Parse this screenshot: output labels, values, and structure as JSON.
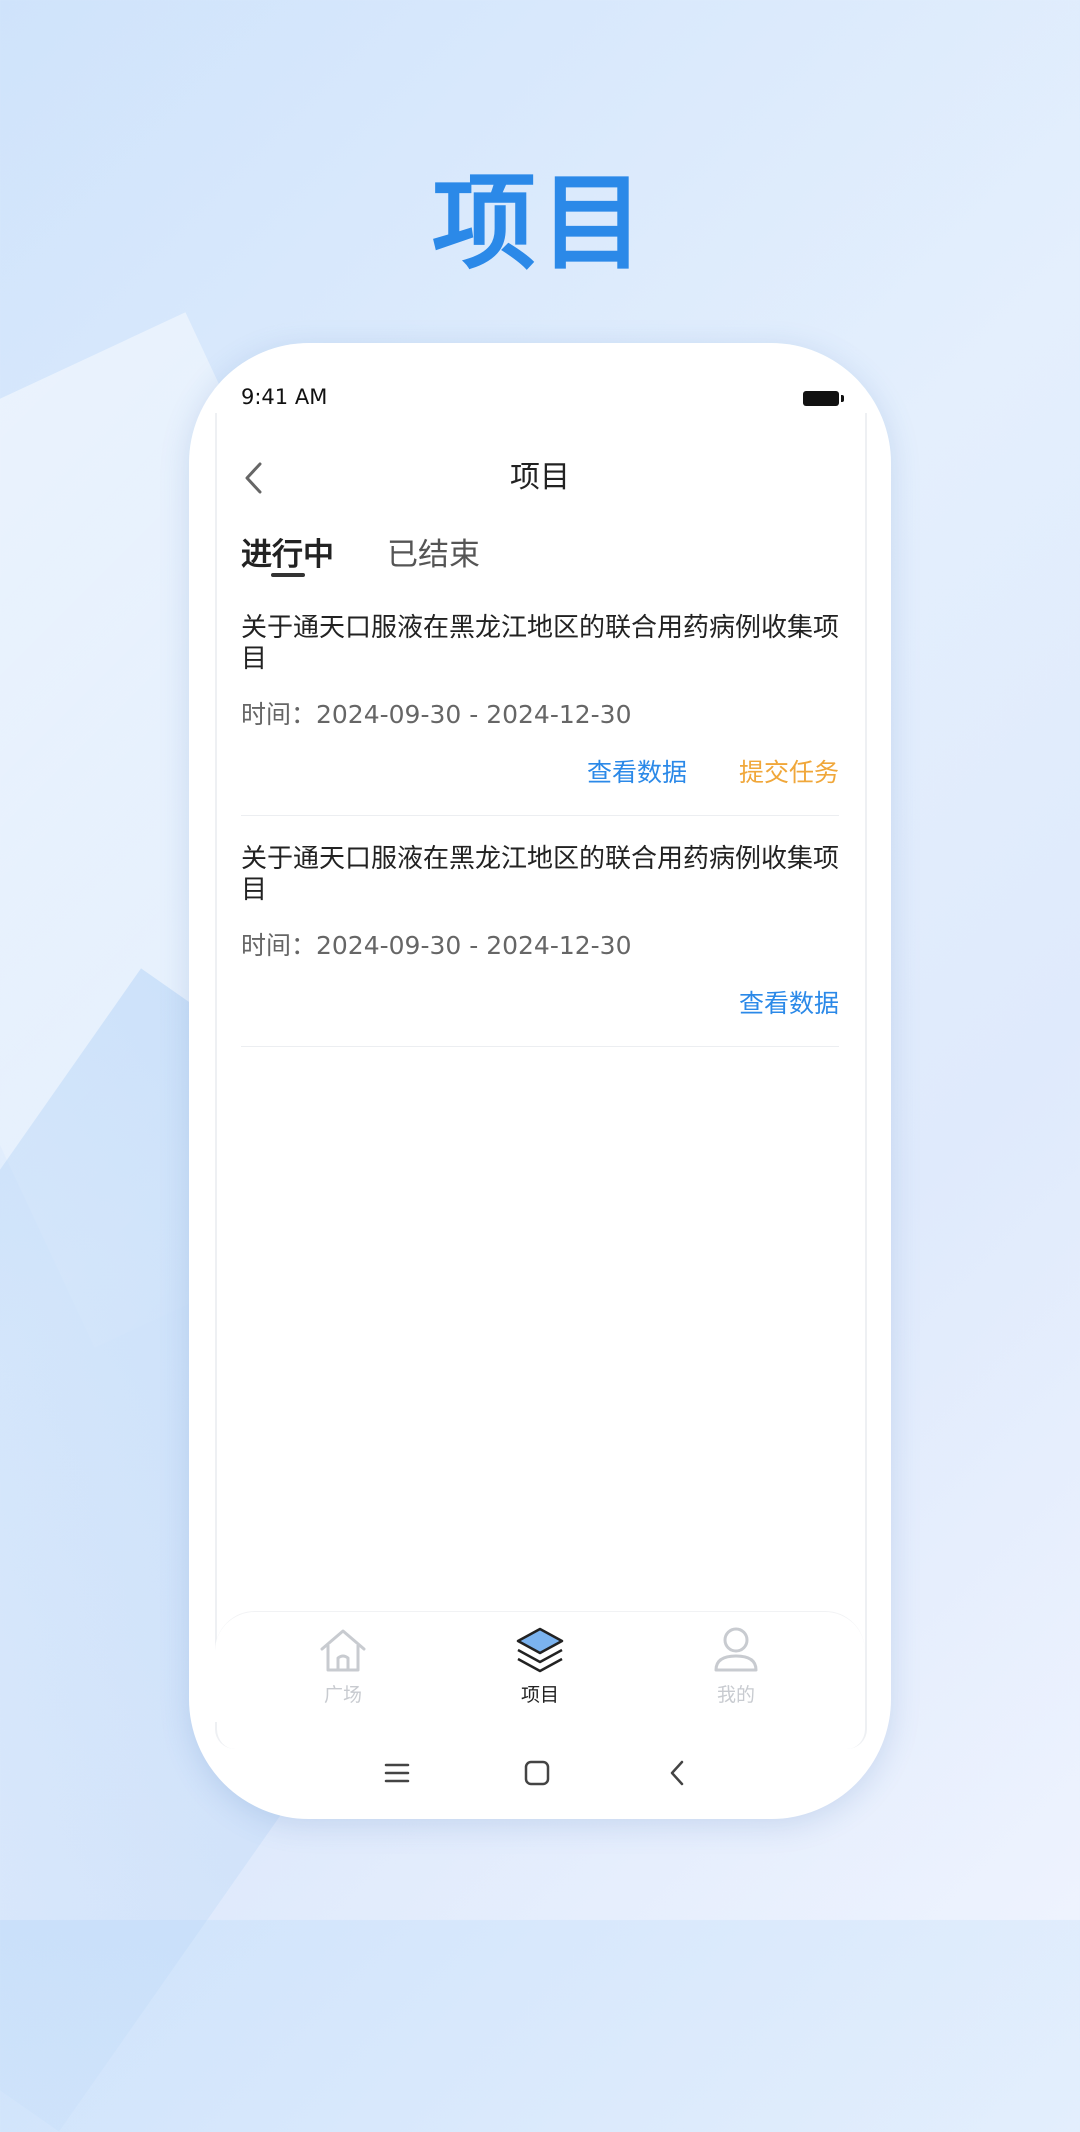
{
  "hero": {
    "title": "项目"
  },
  "status_bar": {
    "time": "9:41 AM"
  },
  "nav": {
    "title": "项目"
  },
  "tabs": [
    {
      "label": "进行中",
      "active": true
    },
    {
      "label": "已结束",
      "active": false
    }
  ],
  "projects": [
    {
      "title": "关于通天口服液在黑龙江地区的联合用药病例收集项目",
      "time": "时间：2024-09-30 - 2024-12-30",
      "actions": [
        "查看数据",
        "提交任务"
      ]
    },
    {
      "title": "关于通天口服液在黑龙江地区的联合用药病例收集项目",
      "time": "时间：2024-09-30 - 2024-12-30",
      "actions": [
        "查看数据"
      ]
    }
  ],
  "tabbar": {
    "items": [
      {
        "label": "广场",
        "icon": "home-icon",
        "active": false
      },
      {
        "label": "项目",
        "icon": "layers-icon",
        "active": true
      },
      {
        "label": "我的",
        "icon": "user-icon",
        "active": false
      }
    ]
  },
  "colors": {
    "accent": "#2b89e8",
    "orange": "#f0a73a"
  }
}
